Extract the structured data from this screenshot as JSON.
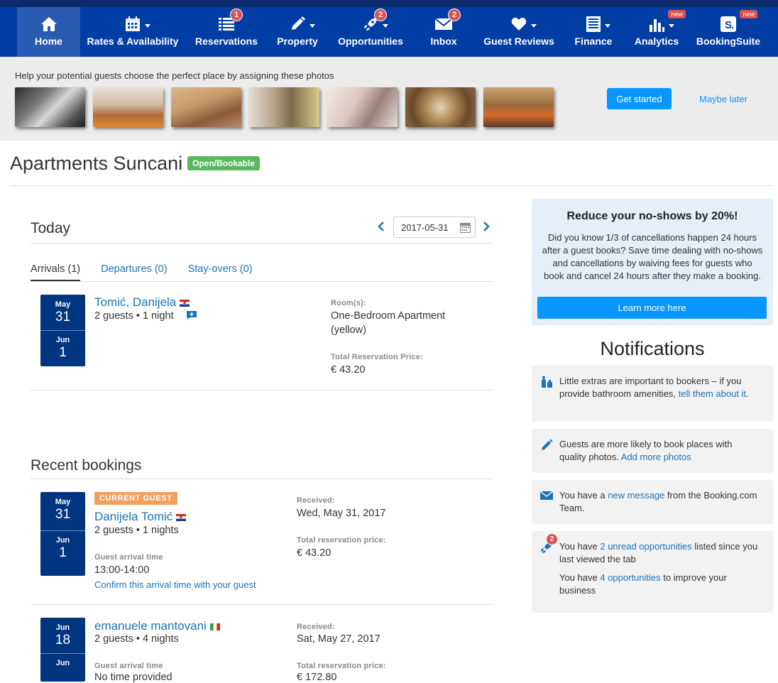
{
  "nav": {
    "items": [
      {
        "label": "Home",
        "icon": "home-icon",
        "active": true
      },
      {
        "label": "Rates & Availability",
        "icon": "calendar-icon",
        "dropdown": true
      },
      {
        "label": "Reservations",
        "icon": "list-icon",
        "badge": "1"
      },
      {
        "label": "Property",
        "icon": "pencil-icon",
        "dropdown": true
      },
      {
        "label": "Opportunities",
        "icon": "rocket-icon",
        "badge": "2",
        "dropdown": true
      },
      {
        "label": "Inbox",
        "icon": "envelope-icon",
        "badge": "2"
      },
      {
        "label": "Guest Reviews",
        "icon": "heart-icon",
        "dropdown": true
      },
      {
        "label": "Finance",
        "icon": "ledger-icon",
        "dropdown": true
      },
      {
        "label": "Analytics",
        "icon": "bar-chart-icon",
        "new": "new",
        "dropdown": true
      },
      {
        "label": "BookingSuite",
        "icon": "bookingsuite-icon",
        "new": "new"
      }
    ],
    "colors": {
      "bar": "#003da5",
      "active": "#2a5bb3",
      "badge": "#d9534f"
    }
  },
  "banner": {
    "text": "Help your potential guests choose the perfect place by assigning these photos",
    "photos": [
      "photo-1",
      "photo-2",
      "photo-3",
      "photo-4",
      "photo-5",
      "photo-6",
      "photo-7"
    ],
    "get_started": "Get started",
    "maybe_later": "Maybe later"
  },
  "property": {
    "name": "Apartments Suncani",
    "status": "Open/Bookable"
  },
  "today": {
    "title": "Today",
    "date": "2017-05-31",
    "tabs": [
      "Arrivals (1)",
      "Departures (0)",
      "Stay-overs (0)"
    ],
    "arrival": {
      "from_month": "May",
      "from_day": "31",
      "to_month": "Jun",
      "to_day": "1",
      "guest": "Tomić, Danijela",
      "summary": "2 guests • 1 night",
      "rooms_label": "Room(s):",
      "room_line1": "One-Bedroom Apartment",
      "room_line2": "(yellow)",
      "price_label": "Total Reservation Price:",
      "price": "€ 43.20"
    }
  },
  "recent": {
    "title": "Recent bookings",
    "bookings": [
      {
        "badge": "CURRENT GUEST",
        "from_month": "May",
        "from_day": "31",
        "to_month": "Jun",
        "to_day": "1",
        "guest": "Danijela Tomić",
        "summary": "2 guests • 1 nights",
        "arrival_label": "Guest arrival time",
        "arrival_time": "13:00-14:00",
        "confirm_link": "Confirm this arrival time with your guest",
        "received_label": "Received:",
        "received": "Wed, May 31, 2017",
        "price_label": "Total reservation price:",
        "price": "€ 43.20"
      },
      {
        "from_month": "Jun",
        "from_day": "18",
        "to_month": "Jun",
        "guest": "emanuele mantovani",
        "summary": "2 guests • 4 nights",
        "arrival_label": "Guest arrival time",
        "arrival_time": "No time provided",
        "received_label": "Received:",
        "received": "Sat, May 27, 2017",
        "price_label": "Total reservation price:",
        "price": "€ 172.80"
      }
    ]
  },
  "promo": {
    "title": "Reduce your no-shows by 20%!",
    "body": "Did you know 1/3 of cancellations happen 24 hours after a guest books? Save time dealing with no-shows and cancellations by waiving fees for guests who book and cancel 24 hours after they make a booking.",
    "button": "Learn more here"
  },
  "notifications": {
    "title": "Notifications",
    "n1_pre": "Little extras are important to bookers – if you provide bathroom amenities, ",
    "n1_link": "tell them about it",
    "n1_post": ".",
    "n2_pre": "Guests are more likely to book places with quality photos. ",
    "n2_link": "Add more photos",
    "n3_pre": "You have a ",
    "n3_link": "new message",
    "n3_post": " from the Booking.com Team.",
    "n4_badge": "2",
    "n4a_pre": "You have ",
    "n4a_link": "2 unread opportunities",
    "n4a_post": " listed since you last viewed the tab",
    "n4b_pre": "You have ",
    "n4b_link": "4 opportunities",
    "n4b_post": " to improve your business"
  }
}
